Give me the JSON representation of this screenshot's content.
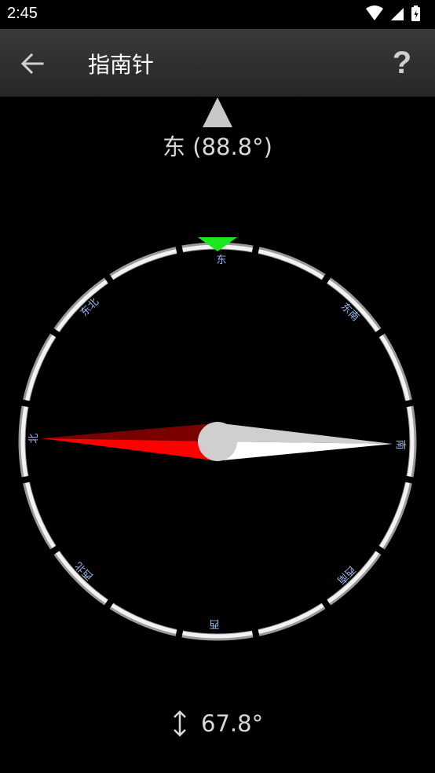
{
  "status_bar": {
    "time": "2:45",
    "icons": [
      "wifi-icon",
      "signal-icon",
      "battery-icon"
    ]
  },
  "app_bar": {
    "title": "指南针",
    "back_icon": "arrow-left-icon",
    "help_label": "?"
  },
  "heading": {
    "text": "东 (88.8°)",
    "direction": "东",
    "degrees": 88.8
  },
  "compass": {
    "labels": {
      "n": "北",
      "ne": "东北",
      "e": "东",
      "se": "东南",
      "s": "南",
      "sw": "西南",
      "w": "西",
      "nw": "西北"
    },
    "indicator_color": "#1ee61e",
    "label_color": "#9ab8f0",
    "needle_north_color": "#ff0000",
    "needle_north_shade": "#7a0000",
    "needle_south_color": "#ffffff",
    "needle_south_shade": "#cfcfcf"
  },
  "tilt": {
    "icon": "vertical-arrows-icon",
    "value": "67.8°"
  }
}
